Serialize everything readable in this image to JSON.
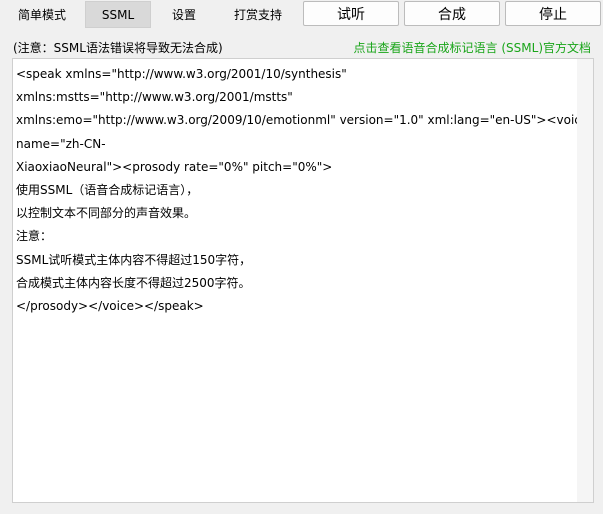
{
  "tabs": [
    {
      "label": "简单模式"
    },
    {
      "label": "SSML",
      "active": true
    },
    {
      "label": "设置"
    },
    {
      "label": "打赏支持"
    }
  ],
  "buttons": {
    "listen": "试听",
    "synthesize": "合成",
    "stop": "停止"
  },
  "notice": "(注意：SSML语法错误将导致无法合成)",
  "doc_link": "点击查看语音合成标记语言 (SSML)官方文档",
  "editor": {
    "lines": [
      "<speak xmlns=\"http://www.w3.org/2001/10/synthesis\"",
      "xmlns:mstts=\"http://www.w3.org/2001/mstts\"",
      "xmlns:emo=\"http://www.w3.org/2009/10/emotionml\" version=\"1.0\" xml:lang=\"en-US\"><voice",
      "name=\"zh-CN-",
      "XiaoxiaoNeural\"><prosody rate=\"0%\" pitch=\"0%\">",
      "使用SSML（语音合成标记语言），",
      "以控制文本不同部分的声音效果。",
      "注意：",
      "SSML试听模式主体内容不得超过150字符，",
      "合成模式主体内容长度不得超过2500字符。",
      "</prosody></voice></speak>"
    ]
  },
  "colors": {
    "link": "#1aa51a",
    "active_tab": "#d9d9d9"
  }
}
